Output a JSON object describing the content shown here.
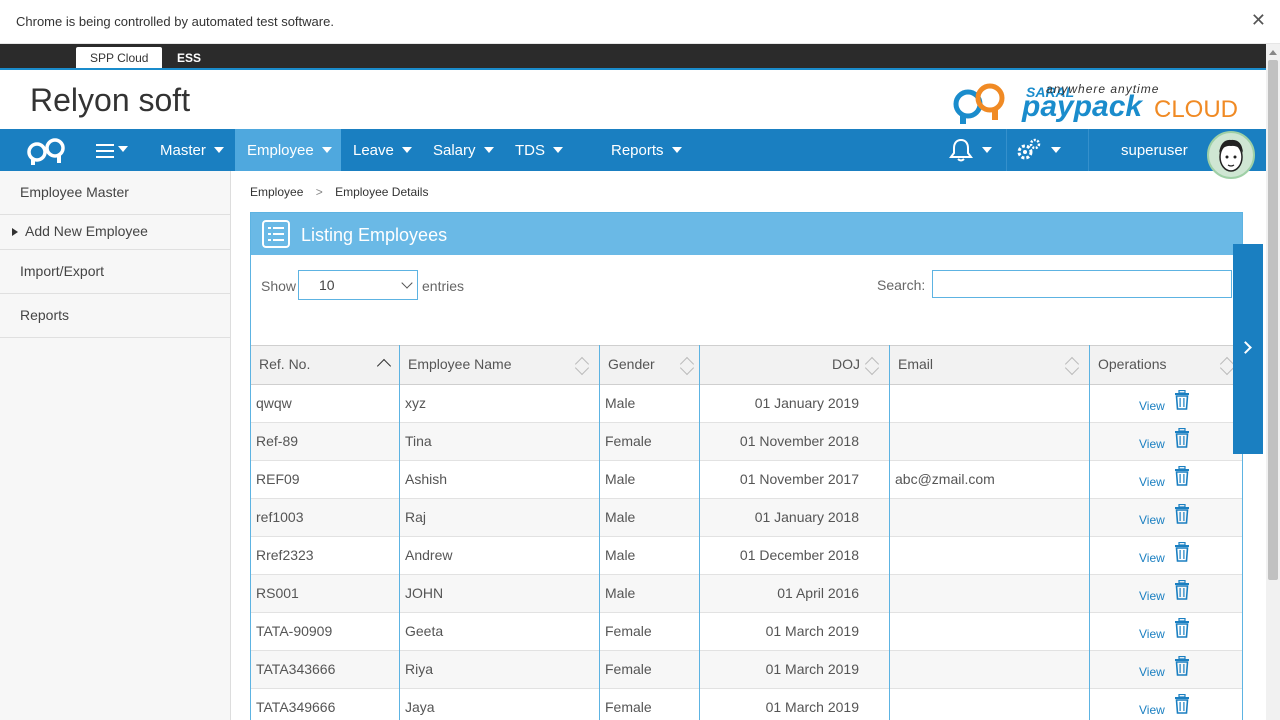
{
  "automation_bar": {
    "message": "Chrome is being controlled by automated test software.",
    "close": "✕"
  },
  "modules": {
    "active": "SPP Cloud",
    "other": "ESS"
  },
  "header": {
    "company": "Relyon soft",
    "brand": {
      "saral": "SARAL",
      "tagline": "anywhere anytime",
      "paypack": "paypack",
      "cloud": "CLOUD"
    }
  },
  "nav": {
    "items": [
      "Master",
      "Employee",
      "Leave",
      "Salary",
      "TDS",
      "Reports"
    ],
    "active": "Employee",
    "username": "superuser"
  },
  "sidebar": {
    "items": [
      "Employee Master",
      "Add New Employee",
      "Import/Export",
      "Reports"
    ]
  },
  "breadcrumb": {
    "parent": "Employee",
    "sep": ">",
    "current": "Employee Details"
  },
  "panel": {
    "title": "Listing Employees",
    "show_label": "Show",
    "show_value": "10",
    "entries_label": "entries",
    "search_label": "Search:",
    "search_value": ""
  },
  "table": {
    "columns": [
      "Ref. No.",
      "Employee Name",
      "Gender",
      "DOJ",
      "Email",
      "Operations"
    ],
    "rows": [
      {
        "ref": "qwqw",
        "name": "xyz",
        "gender": "Male",
        "doj": "01 January 2019",
        "email": "",
        "view": "View"
      },
      {
        "ref": "Ref-89",
        "name": "Tina",
        "gender": "Female",
        "doj": "01 November 2018",
        "email": "",
        "view": "View"
      },
      {
        "ref": "REF09",
        "name": "Ashish",
        "gender": "Male",
        "doj": "01 November 2017",
        "email": "abc@zmail.com",
        "view": "View"
      },
      {
        "ref": "ref1003",
        "name": "Raj",
        "gender": "Male",
        "doj": "01 January 2018",
        "email": "",
        "view": "View"
      },
      {
        "ref": "Rref2323",
        "name": "Andrew",
        "gender": "Male",
        "doj": "01 December 2018",
        "email": "",
        "view": "View"
      },
      {
        "ref": "RS001",
        "name": "JOHN",
        "gender": "Male",
        "doj": "01 April 2016",
        "email": "",
        "view": "View"
      },
      {
        "ref": "TATA-90909",
        "name": "Geeta",
        "gender": "Female",
        "doj": "01 March 2019",
        "email": "",
        "view": "View"
      },
      {
        "ref": "TATA343666",
        "name": "Riya",
        "gender": "Female",
        "doj": "01 March 2019",
        "email": "",
        "view": "View"
      },
      {
        "ref": "TATA349666",
        "name": "Jaya",
        "gender": "Female",
        "doj": "01 March 2019",
        "email": "",
        "view": "View"
      }
    ]
  },
  "colors": {
    "nav_blue": "#1a7fc1",
    "panel_header": "#6ab9e6",
    "accent_orange": "#f08a24"
  }
}
